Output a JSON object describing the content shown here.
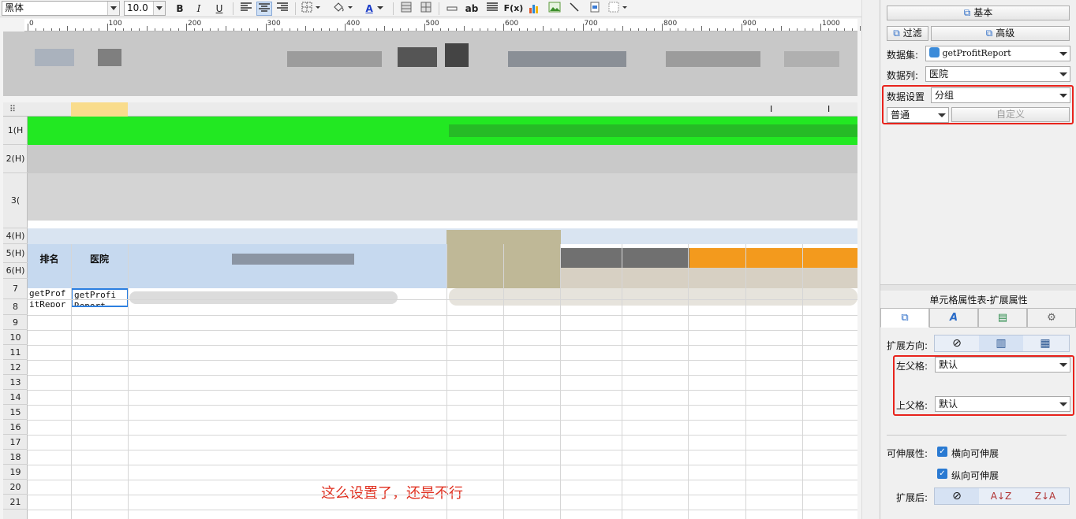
{
  "toolbar": {
    "font_name": "黑体",
    "font_size": "10.0",
    "bold": "B",
    "italic": "I",
    "underline": "U",
    "text_color_label": "A",
    "ab_label": "ab",
    "fx_label": "F(x)"
  },
  "ruler": {
    "ticks": [
      "0",
      "100",
      "200",
      "300",
      "400",
      "500",
      "600",
      "700",
      "800",
      "900",
      "1000"
    ]
  },
  "grid": {
    "column_header_label": "I",
    "header_cells": {
      "rank": "排名",
      "hospital": "医院"
    },
    "data_cells": {
      "rank_value": "getProf\nitRepor",
      "hospital_value": "getProfi\nReport"
    },
    "row_numbers": [
      "1(H",
      "2(H)",
      "3(",
      "4(H)",
      "5(H)",
      "6(H)",
      "7",
      "8",
      "9",
      "10",
      "11",
      "12",
      "13",
      "14",
      "15",
      "16",
      "17",
      "18",
      "19",
      "20",
      "21"
    ],
    "annotation": "这么设置了，还是不行"
  },
  "panel": {
    "basic_button": "基本",
    "filter_button": "过滤",
    "advanced_button": "高级",
    "dataset_label": "数据集:",
    "dataset_value": "getProfitReport",
    "datacol_label": "数据列:",
    "datacol_value": "医院",
    "datasetting_label": "数据设置",
    "datasetting_value": "分组",
    "mode_value": "普通",
    "custom_button": "自定义",
    "section_title": "单元格属性表-扩展属性",
    "expand_dir_label": "扩展方向:",
    "left_parent_label": "左父格:",
    "left_parent_value": "默认",
    "top_parent_label": "上父格:",
    "top_parent_value": "默认",
    "stretch_label": "可伸展性:",
    "horizontal_stretch": "横向可伸展",
    "vertical_stretch": "纵向可伸展",
    "after_expand_label": "扩展后:"
  },
  "colors": {
    "highlight_red": "#e8231c",
    "green_band": "#22e822",
    "header_blue": "#c6d9ef",
    "checkbox_blue": "#2a7ad2"
  }
}
